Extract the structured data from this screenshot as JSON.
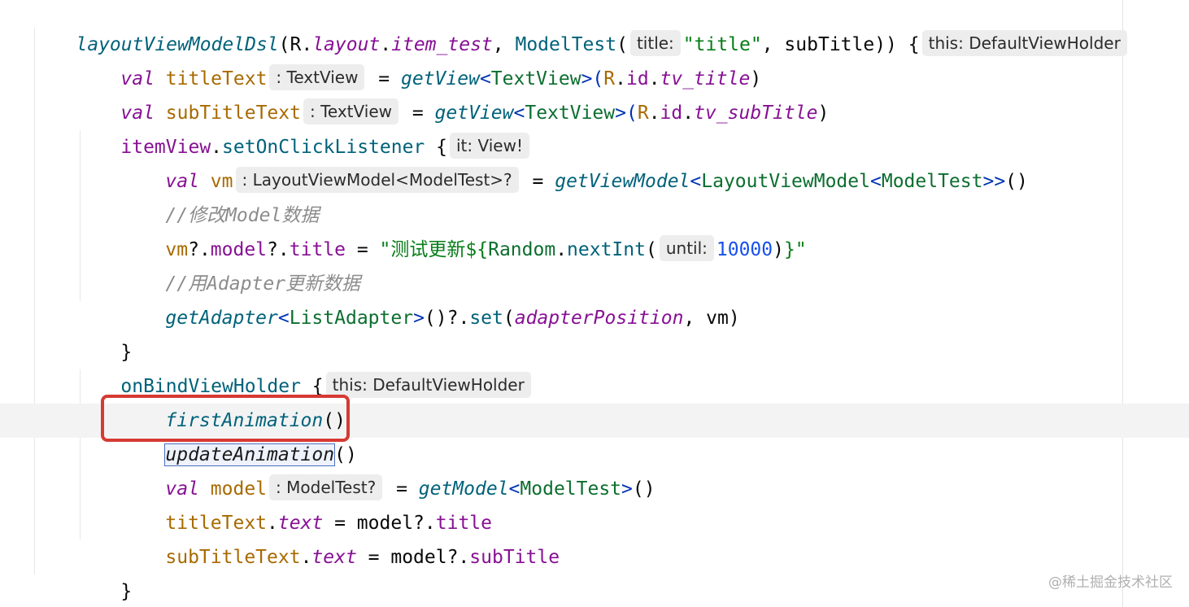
{
  "colors": {
    "keyword": "#0033b3",
    "val": "#871094",
    "function": "#00627a",
    "class": "#0c6e2f",
    "string": "#067d17",
    "number": "#1750eb",
    "comment": "#8c8c8c",
    "highlight_box": "#d63a33",
    "current_line": "#f3f3f3",
    "inlay_background": "#ededed"
  },
  "code": {
    "l1": {
      "fn": "layoutViewModelDsl",
      "p1": "(R.",
      "layout": "layout",
      "dot": ".",
      "item": "item_test",
      "comma": ", ",
      "model": "ModelTest",
      "open": "(",
      "hint_title": "title:",
      "title_str": "\"title\"",
      "rest": ", subTitle)) {",
      "hint_this": "this: DefaultViewHolder"
    },
    "l2": {
      "val": "val",
      "name": "titleText",
      "hint": ": TextView",
      "eq": "= ",
      "fn": "getView",
      "lt": "<",
      "cls": "TextView",
      "gt": ">(",
      "r": "R",
      "dot1": ".",
      "id": "id",
      "dot2": ".",
      "res": "tv_title",
      "close": ")"
    },
    "l3": {
      "val": "val",
      "name": "subTitleText",
      "hint": ": TextView",
      "eq": "= ",
      "fn": "getView",
      "lt": "<",
      "cls": "TextView",
      "gt": ">(",
      "r": "R",
      "dot1": ".",
      "id": "id",
      "dot2": ".",
      "res": "tv_subTitle",
      "close": ")"
    },
    "l4": {
      "obj": "itemView",
      "dot": ".",
      "fn": "setOnClickListener",
      "brace": " {",
      "hint": "it: View!"
    },
    "l5": {
      "val": "val",
      "name": "vm",
      "hint": ": LayoutViewModel<ModelTest>?",
      "eq": "= ",
      "fn": "getViewModel",
      "lt": "<",
      "cls1": "LayoutViewModel",
      "lt2": "<",
      "cls2": "ModelTest",
      "gt": ">>",
      "close": "()"
    },
    "l6": {
      "comment": "//修改Model数据"
    },
    "l7": {
      "vm": "vm",
      "q1": "?.",
      "model": "model",
      "q2": "?.",
      "title": "title",
      "eq": " = ",
      "str1": "\"测试更新${",
      "random": "Random",
      "dot": ".",
      "fn": "nextInt",
      "open": "(",
      "hint": "until:",
      "num": "10000",
      "close": ")",
      "str2": "}\""
    },
    "l8": {
      "comment": "//用Adapter更新数据"
    },
    "l9": {
      "fn": "getAdapter",
      "lt": "<",
      "cls": "ListAdapter",
      "gt": ">",
      "call": "()?.",
      "set": "set",
      "open": "(",
      "pos": "adapterPosition",
      "rest": ", vm)"
    },
    "l10": {
      "brace": "}"
    },
    "l11": {
      "fn": "onBindViewHolder",
      "brace": " {",
      "hint": "this: DefaultViewHolder"
    },
    "l12": {
      "fn": "firstAnimation",
      "close": "()"
    },
    "l13": {
      "fn": "updateAnimation",
      "close": "()"
    },
    "l14": {
      "val": "val",
      "name": "model",
      "hint": ": ModelTest?",
      "eq": "= ",
      "fn": "getModel",
      "lt": "<",
      "cls": "ModelTest",
      "gt": ">",
      "close": "()"
    },
    "l15": {
      "obj": "titleText",
      "dot": ".",
      "prop": "text",
      "eq": " = model?.",
      "field": "title"
    },
    "l16": {
      "obj": "subTitleText",
      "dot": ".",
      "prop": "text",
      "eq": " = model?.",
      "field": "subTitle"
    },
    "l17": {
      "brace": "}"
    },
    "l18": {
      "brace": "}"
    }
  },
  "watermark": "@稀土掘金技术社区"
}
